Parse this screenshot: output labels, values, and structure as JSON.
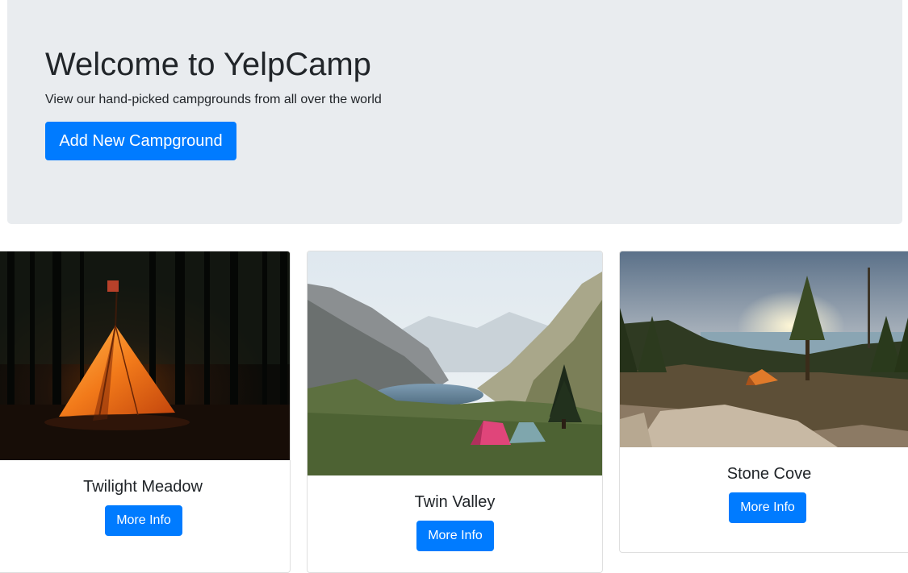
{
  "hero": {
    "title": "Welcome to YelpCamp",
    "subtitle": "View our hand-picked campgrounds from all over the world",
    "add_button_label": "Add New Campground"
  },
  "campgrounds": [
    {
      "name": "Twilight Meadow",
      "button_label": "More Info",
      "image": "tent-forest-night-photo"
    },
    {
      "name": "Twin Valley",
      "button_label": "More Info",
      "image": "mountain-lake-valley-tents-photo"
    },
    {
      "name": "Stone Cove",
      "button_label": "More Info",
      "image": "sunset-lake-rocks-tent-photo"
    }
  ],
  "colors": {
    "primary": "#007bff",
    "jumbotron_bg": "#e9ecef",
    "text": "#212529"
  }
}
